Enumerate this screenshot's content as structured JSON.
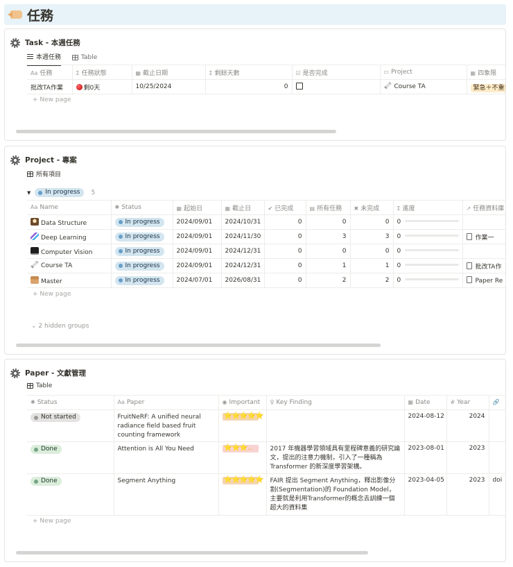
{
  "page": {
    "title": "任務"
  },
  "task": {
    "title": "Task - 本週任務",
    "tabs": [
      "本週任務",
      "Table"
    ],
    "columns": [
      "任務",
      "任務狀態",
      "截止日期",
      "剩餘天數",
      "是否完成",
      "Project",
      "四象限"
    ],
    "column_icons": [
      "Aa",
      "Σ",
      "▦",
      "Σ",
      "☑",
      "▭",
      "▦"
    ],
    "rows": [
      {
        "name": "批改TA作業",
        "status": "剩0天",
        "due": "10/25/2024",
        "remaining": "0",
        "project": "Course TA",
        "quadrant": "緊急＋不重!"
      }
    ],
    "new_page": "New page"
  },
  "project": {
    "title": "Project - 專案",
    "tab": "所有項目",
    "group_label": "In progress",
    "group_count": "5",
    "columns": [
      "Name",
      "Status",
      "起始日",
      "截止日",
      "已完成",
      "所有任務",
      "未完成",
      "進度",
      "任務資料庫"
    ],
    "column_icons": [
      "Aa",
      "✺",
      "▦",
      "▦",
      "✔",
      "▤",
      "✖",
      "Σ",
      "↗"
    ],
    "rows": [
      {
        "name": "Data Structure",
        "status": "In progress",
        "start": "2024/09/01",
        "end": "2024/10/31",
        "done": "0",
        "all": "0",
        "undone": "0",
        "progress": "0",
        "tasks": ""
      },
      {
        "name": "Deep Learning",
        "status": "In progress",
        "start": "2024/09/01",
        "end": "2024/11/30",
        "done": "0",
        "all": "3",
        "undone": "3",
        "progress": "0",
        "tasks": "作業一"
      },
      {
        "name": "Computer Vision",
        "status": "In progress",
        "start": "2024/09/01",
        "end": "2024/12/31",
        "done": "0",
        "all": "0",
        "undone": "0",
        "progress": "0",
        "tasks": ""
      },
      {
        "name": "Course TA",
        "status": "In progress",
        "start": "2024/09/01",
        "end": "2024/12/31",
        "done": "0",
        "all": "1",
        "undone": "1",
        "progress": "0",
        "tasks": "批改TA作"
      },
      {
        "name": "Master",
        "status": "In progress",
        "start": "2024/07/01",
        "end": "2026/08/31",
        "done": "0",
        "all": "2",
        "undone": "2",
        "progress": "0",
        "tasks": "Paper Re"
      }
    ],
    "new_page": "New page",
    "hidden_groups": "2 hidden groups"
  },
  "paper": {
    "title": "Paper - 文獻管理",
    "tab": "Table",
    "columns": [
      "Status",
      "Paper",
      "Important",
      "Key Finding",
      "Date",
      "Year"
    ],
    "column_icons": [
      "✺",
      "Aa",
      "◉",
      "♀",
      "▦",
      "#"
    ],
    "rows": [
      {
        "status": "Not started",
        "paper": "FruitNeRF: A unified neural radiance field based fruit counting framework",
        "important": "⭐⭐⭐⭐⭐",
        "finding": "",
        "date": "2024-08-12",
        "year": "2024",
        "extra": ""
      },
      {
        "status": "Done",
        "paper": "Attention is All You Need",
        "important": "⭐⭐⭐...",
        "finding": "2017 年機器學習領域具有里程碑意義的研究論文，提出的注意力機制，引入了一種稱為 Transformer 的新深度學習架構。",
        "date": "2023-08-01",
        "year": "2023",
        "extra": ""
      },
      {
        "status": "Done",
        "paper": "Segment Anything",
        "important": "⭐⭐⭐⭐⭐",
        "finding": "FAIR 提出 Segment Anything，釋出影像分割(Segmentation)的 Foundation Model，主要就是利用Transformer的概念去訓練一個超大的資料集",
        "date": "2023-04-05",
        "year": "2023",
        "extra": "doi"
      }
    ],
    "new_page": "New page"
  },
  "colors": {
    "header_bg": "#e7f3f8",
    "pill_blue": "#d3e5ef",
    "pill_green": "#dbeddb",
    "pill_gray": "#e3e2e0",
    "tag_yellow": "#fdecc8"
  }
}
